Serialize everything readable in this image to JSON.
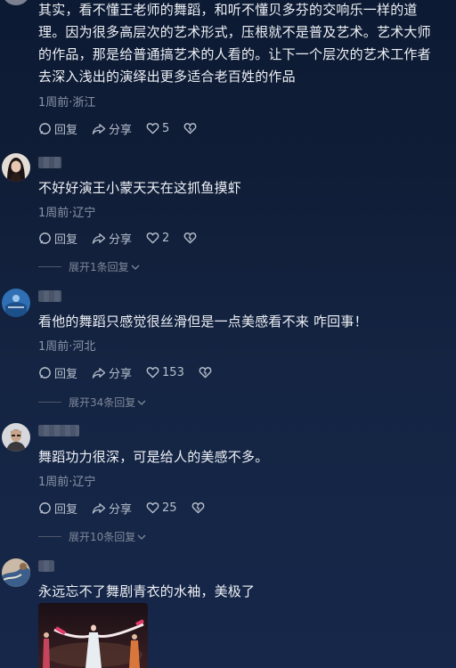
{
  "comments": [
    {
      "text": "其实，看不懂王老师的舞蹈，和听不懂贝多芬的交响乐一样的道理。因为很多高层次的艺术形式，压根就不是普及艺术。艺术大师的作品，那是给普通搞艺术的人看的。让下一个层次的艺术工作者去深入浅出的演绎出更多适合老百姓的作品",
      "meta": "1周前·浙江",
      "reply": "回复",
      "share": "分享",
      "likes": "5"
    },
    {
      "text": "不好好演王小蒙天天在这抓鱼摸虾",
      "meta": "1周前·辽宁",
      "reply": "回复",
      "share": "分享",
      "likes": "2",
      "expand": "展开1条回复"
    },
    {
      "text": "看他的舞蹈只感觉很丝滑但是一点美感看不来 咋回事！",
      "meta": "1周前·河北",
      "reply": "回复",
      "share": "分享",
      "likes": "153",
      "expand": "展开34条回复"
    },
    {
      "text": "舞蹈功力很深，可是给人的美感不多。",
      "meta": "1周前·辽宁",
      "reply": "回复",
      "share": "分享",
      "likes": "25",
      "expand": "展开10条回复"
    },
    {
      "text": "永远忘不了舞剧青衣的水袖，美极了"
    }
  ],
  "colors": {
    "background": "#101d37",
    "text": "#eef1f6",
    "meta": "#8b95a8"
  },
  "icons": [
    "comment-icon",
    "share-icon",
    "heart-icon",
    "dislike-heart-icon",
    "chevron-down-icon"
  ]
}
